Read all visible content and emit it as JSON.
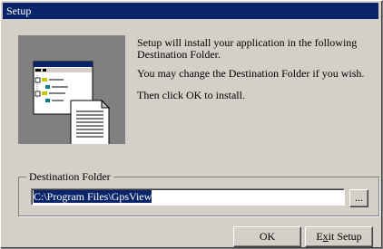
{
  "window": {
    "title": "Setup"
  },
  "messages": {
    "line1a": "Setup will install your application in the following",
    "line1b": "Destination Folder.",
    "line2": "You may change the Destination Folder if you wish.",
    "line3": "Then click OK to install."
  },
  "destination": {
    "group_label": "Destination Folder",
    "path": "C:\\Program Files\\GpsView",
    "browse_label": "..."
  },
  "buttons": {
    "ok": "OK",
    "exit_prefix": "E",
    "exit_mnemonic": "x",
    "exit_suffix": "it Setup"
  }
}
